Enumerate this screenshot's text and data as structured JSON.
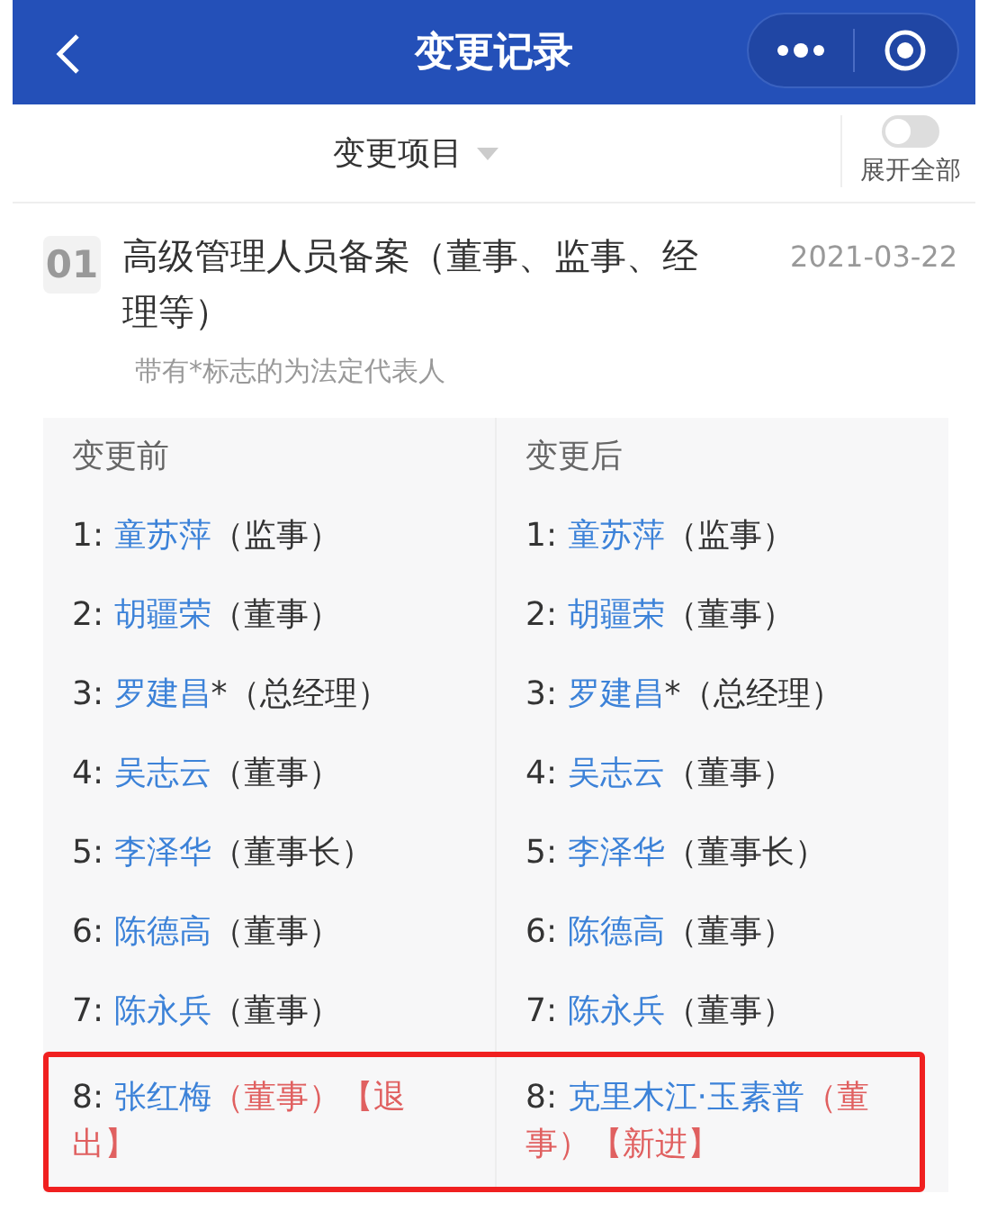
{
  "nav": {
    "title": "变更记录"
  },
  "filter": {
    "label": "变更项目",
    "toggle_label": "展开全部",
    "on": false
  },
  "record": {
    "number": "01",
    "title": "高级管理人员备案（董事、监事、经理等）",
    "date": "2021-03-22",
    "note": "带有*标志的为法定代表人"
  },
  "columns": [
    "变更前",
    "变更后"
  ],
  "rows": [
    {
      "highlighted": false,
      "cells": [
        {
          "index": "1:",
          "name": "童苏萍",
          "role": "（监事）",
          "kind": "same"
        },
        {
          "index": "1:",
          "name": "童苏萍",
          "role": "（监事）",
          "kind": "same"
        }
      ]
    },
    {
      "highlighted": false,
      "cells": [
        {
          "index": "2:",
          "name": "胡疆荣",
          "role": "（董事）",
          "kind": "same"
        },
        {
          "index": "2:",
          "name": "胡疆荣",
          "role": "（董事）",
          "kind": "same"
        }
      ]
    },
    {
      "highlighted": false,
      "cells": [
        {
          "index": "3:",
          "name": "罗建昌",
          "marker": "*",
          "role": "（总经理）",
          "kind": "same"
        },
        {
          "index": "3:",
          "name": "罗建昌",
          "marker": "*",
          "role": "（总经理）",
          "kind": "same"
        }
      ]
    },
    {
      "highlighted": false,
      "cells": [
        {
          "index": "4:",
          "name": "吴志云",
          "role": "（董事）",
          "kind": "same"
        },
        {
          "index": "4:",
          "name": "吴志云",
          "role": "（董事）",
          "kind": "same"
        }
      ]
    },
    {
      "highlighted": false,
      "cells": [
        {
          "index": "5:",
          "name": "李泽华",
          "role": "（董事长）",
          "kind": "same"
        },
        {
          "index": "5:",
          "name": "李泽华",
          "role": "（董事长）",
          "kind": "same"
        }
      ]
    },
    {
      "highlighted": false,
      "cells": [
        {
          "index": "6:",
          "name": "陈德高",
          "role": "（董事）",
          "kind": "same"
        },
        {
          "index": "6:",
          "name": "陈德高",
          "role": "（董事）",
          "kind": "same"
        }
      ]
    },
    {
      "highlighted": false,
      "cells": [
        {
          "index": "7:",
          "name": "陈永兵",
          "role": "（董事）",
          "kind": "same"
        },
        {
          "index": "7:",
          "name": "陈永兵",
          "role": "（董事）",
          "kind": "same"
        }
      ]
    },
    {
      "highlighted": true,
      "cells": [
        {
          "index": "8:",
          "name": "张红梅",
          "role": "（董事）",
          "kind": "changed",
          "tag": "【退出】"
        },
        {
          "index": "8:",
          "name": "克里木江·玉素普",
          "role": "（董事）",
          "kind": "changed",
          "tag": "【新进】"
        }
      ]
    }
  ]
}
